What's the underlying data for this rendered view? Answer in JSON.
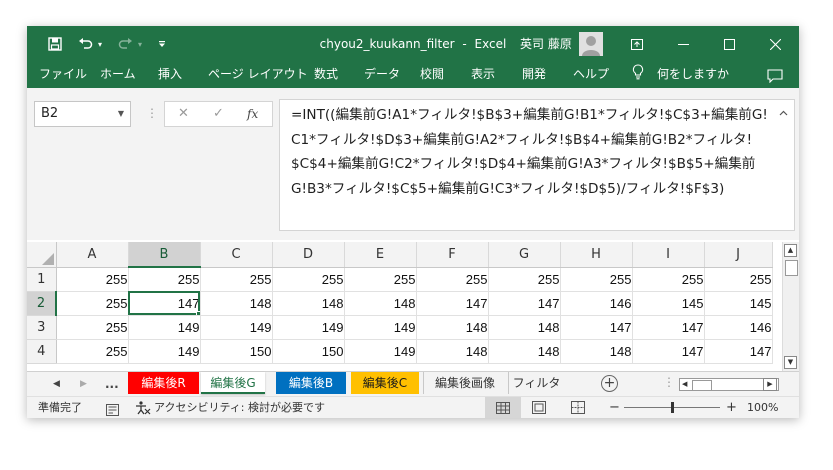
{
  "titlebar": {
    "filename": "chyou2_kuukann_filter",
    "app": "Excel",
    "separator": "-",
    "user": "英司 藤原",
    "icons": [
      "save-icon",
      "undo-icon",
      "redo-icon",
      "customize-icon",
      "ribbon-display-icon",
      "minimize-icon",
      "maximize-icon",
      "close-icon"
    ]
  },
  "ribbon": {
    "tabs": [
      "ファイル",
      "ホーム",
      "挿入",
      "ページ レイアウト",
      "数式",
      "データ",
      "校閲",
      "表示",
      "開発",
      "ヘルプ"
    ],
    "search": "何をしますか"
  },
  "formula_bar": {
    "name_box": "B2",
    "cancel": "✕",
    "enter": "✓",
    "fx": "fx",
    "formula": "=INT((編集前G!A1*フィルタ!$B$3+編集前G!B1*フィルタ!$C$3+編集前G!C1*フィルタ!$D$3+編集前G!A2*フィルタ!$B$4+編集前G!B2*フィルタ!$C$4+編集前G!C2*フィルタ!$D$4+編集前G!A3*フィルタ!$B$5+編集前G!B3*フィルタ!$C$5+編集前G!C3*フィルタ!$D$5)/フィルタ!$F$3)"
  },
  "sheet": {
    "columns": [
      "A",
      "B",
      "C",
      "D",
      "E",
      "F",
      "G",
      "H",
      "I",
      "J"
    ],
    "selected_column": "B",
    "selected_row": "2",
    "rows": [
      {
        "n": "1",
        "cells": [
          "255",
          "255",
          "255",
          "255",
          "255",
          "255",
          "255",
          "255",
          "255",
          "255"
        ]
      },
      {
        "n": "2",
        "cells": [
          "255",
          "147",
          "148",
          "148",
          "148",
          "147",
          "147",
          "146",
          "145",
          "145"
        ]
      },
      {
        "n": "3",
        "cells": [
          "255",
          "149",
          "149",
          "149",
          "149",
          "148",
          "148",
          "147",
          "147",
          "146"
        ]
      },
      {
        "n": "4",
        "cells": [
          "255",
          "149",
          "150",
          "150",
          "149",
          "148",
          "148",
          "148",
          "147",
          "147"
        ]
      }
    ]
  },
  "sheet_tabs": {
    "ellipsis": "...",
    "tabs": [
      {
        "label": "編集後R",
        "color": "#ff0000",
        "text": "#ffffff"
      },
      {
        "label": "編集後G",
        "color": "#ffffff",
        "text": "#217346",
        "active": true
      },
      {
        "label": "編集後B",
        "color": "#0070c0",
        "text": "#ffffff"
      },
      {
        "label": "編集後C",
        "color": "#ffc000",
        "text": "#1a1a1a"
      },
      {
        "label": "編集後画像",
        "color": "#f3f3f3",
        "text": "#333333"
      },
      {
        "label": "フィルタ",
        "color": "#f3f3f3",
        "text": "#333333"
      }
    ],
    "add": "+"
  },
  "status": {
    "ready": "準備完了",
    "accessibility": "アクセシビリティ: 検討が必要です",
    "zoom_minus": "−",
    "zoom_plus": "+",
    "zoom": "100%",
    "zoom_level": 0.5
  },
  "colors": {
    "excel_green": "#217346"
  }
}
